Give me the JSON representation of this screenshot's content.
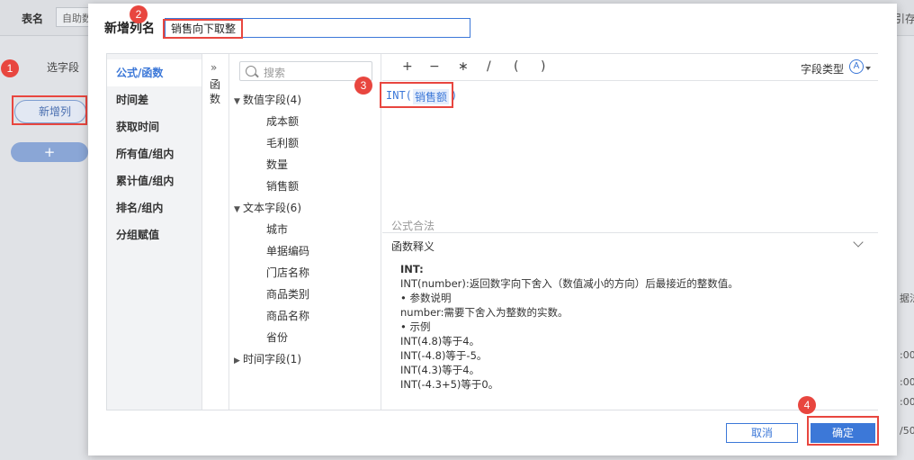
{
  "background": {
    "table_name_label": "表名",
    "table_name_value": "自助数",
    "top_right_text": "引存",
    "select_field_tab": "选字段",
    "new_column_item": "新增列",
    "add_button": "+",
    "right_cells": [
      "据法",
      ":00",
      ":00",
      ":00",
      "/50"
    ]
  },
  "steps": [
    "1",
    "2",
    "3",
    "4"
  ],
  "dialog": {
    "title": "新增列名",
    "column_name_value": "销售向下取整",
    "categories": [
      {
        "label": "公式/函数"
      },
      {
        "label": "时间差"
      },
      {
        "label": "获取时间"
      },
      {
        "label": "所有值/组内"
      },
      {
        "label": "累计值/组内"
      },
      {
        "label": "排名/组内"
      },
      {
        "label": "分组赋值"
      }
    ],
    "function_tab_expand": "»",
    "function_tab_label": "函数",
    "search_placeholder": "搜索",
    "tree": {
      "numeric_group": "数值字段(4)",
      "numeric_fields": [
        "成本额",
        "毛利额",
        "数量",
        "销售额"
      ],
      "text_group": "文本字段(6)",
      "text_fields": [
        "城市",
        "单据编码",
        "门店名称",
        "商品类别",
        "商品名称",
        "省份"
      ],
      "time_group": "时间字段(1)"
    },
    "operators": [
      "+",
      "−",
      "∗",
      "/",
      "(",
      ")"
    ],
    "field_type_label": "字段类型",
    "field_type_icon": "A",
    "formula": {
      "function_text": "INT(",
      "field_token": "销售额",
      "close_paren": ")"
    },
    "formula_status": "公式合法",
    "description": {
      "header": "函数释义",
      "lines": [
        "INT:",
        "INT(number):返回数字向下舍入（数值减小的方向）后最接近的整数值。",
        "• 参数说明",
        "number:需要下舍入为整数的实数。",
        "• 示例",
        "INT(4.8)等于4。",
        "INT(-4.8)等于-5。",
        "INT(4.3)等于4。",
        "INT(-4.3+5)等于0。"
      ]
    },
    "cancel_label": "取消",
    "ok_label": "确定"
  },
  "colors": {
    "accent": "#3c78d8",
    "highlight": "#e8463f"
  }
}
